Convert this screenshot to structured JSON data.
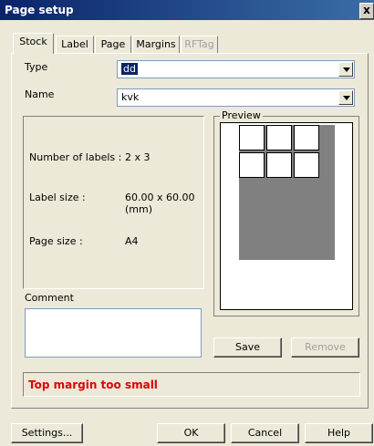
{
  "window": {
    "title": "Page setup",
    "close_glyph": "x"
  },
  "tabs": [
    {
      "label": "Stock",
      "active": true,
      "enabled": true
    },
    {
      "label": "Label",
      "active": false,
      "enabled": true
    },
    {
      "label": "Page",
      "active": false,
      "enabled": true
    },
    {
      "label": "Margins",
      "active": false,
      "enabled": true
    },
    {
      "label": "RFTag",
      "active": false,
      "enabled": false
    }
  ],
  "stock": {
    "type_label": "Type",
    "type_value": "dd",
    "name_label": "Name",
    "name_value": "kvk",
    "number_of_labels_label": "Number of labels :",
    "number_of_labels_value": "2 x 3",
    "label_size_label": "Label size :",
    "label_size_value": "60.00 x 60.00 (mm)",
    "page_size_label": "Page size :",
    "page_size_value": "A4",
    "comment_label": "Comment",
    "comment_value": "",
    "preview_label": "Preview"
  },
  "buttons": {
    "save": "Save",
    "remove": "Remove",
    "settings": "Settings...",
    "ok": "OK",
    "cancel": "Cancel",
    "help": "Help"
  },
  "status_message": "Top margin too small",
  "colors": {
    "title_bar": "#0a246a",
    "status_text": "#e00000",
    "dialog_bg": "#ece9d8"
  }
}
